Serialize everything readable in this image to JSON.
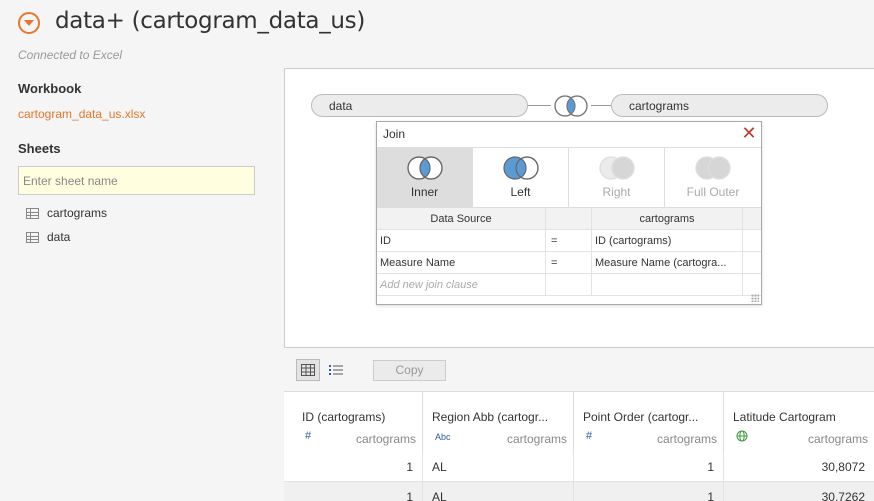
{
  "header": {
    "title": "data+ (cartogram_data_us)",
    "connection_status": "Connected to Excel"
  },
  "left_panel": {
    "workbook_heading": "Workbook",
    "workbook_file": "cartogram_data_us.xlsx",
    "sheets_heading": "Sheets",
    "sheet_search_placeholder": "Enter sheet name",
    "sheets": [
      {
        "label": "cartograms",
        "icon": "sheet-grid-icon"
      },
      {
        "label": "data",
        "icon": "sheet-grid-icon"
      }
    ]
  },
  "canvas": {
    "left_table": "data",
    "right_table": "cartograms",
    "join_icon": "left-join-icon"
  },
  "join_dialog": {
    "title": "Join",
    "join_types": [
      {
        "label": "Inner",
        "state": "selected"
      },
      {
        "label": "Left",
        "state": "enabled"
      },
      {
        "label": "Right",
        "state": "disabled"
      },
      {
        "label": "Full Outer",
        "state": "disabled"
      }
    ],
    "columns": {
      "left": "Data Source",
      "right": "cartograms"
    },
    "clauses": [
      {
        "left": "ID",
        "op": "=",
        "right": "ID (cartograms)"
      },
      {
        "left": "Measure Name",
        "op": "=",
        "right": "Measure Name (cartogra..."
      }
    ],
    "add_clause_placeholder": "Add new join clause",
    "colors": {
      "selected_fill": "#5b9bd5",
      "disabled": "#cfcfcf"
    }
  },
  "toolbar": {
    "grid_view_icon": "grid-view-icon",
    "list_view_icon": "list-view-icon",
    "copy_label": "Copy"
  },
  "data_grid": {
    "columns": [
      {
        "name": "ID (cartograms)",
        "type_icon": "#",
        "source": "cartograms"
      },
      {
        "name": "Region Abb (cartogr...",
        "type_icon": "Abc",
        "source": "cartograms"
      },
      {
        "name": "Point Order (cartogr...",
        "type_icon": "#",
        "source": "cartograms"
      },
      {
        "name": "Latitude Cartogram",
        "type_icon": "globe",
        "source": "cartograms"
      }
    ],
    "rows": [
      [
        "1",
        "AL",
        "1",
        "30,8072"
      ],
      [
        "1",
        "AL",
        "1",
        "30,7262"
      ]
    ]
  },
  "colors": {
    "accent": "#e8762c",
    "link": "#e8762c"
  }
}
